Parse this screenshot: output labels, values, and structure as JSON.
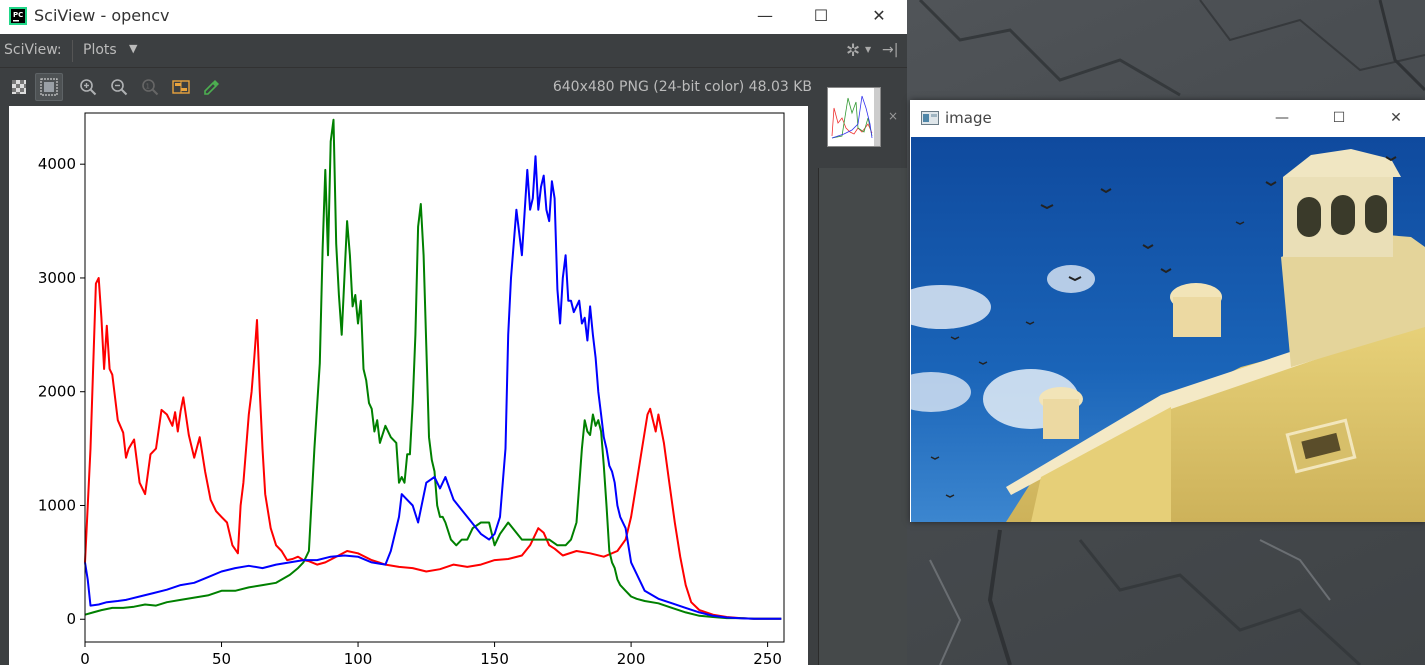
{
  "sciview_window": {
    "title": "SciView - opencv",
    "min_glyph": "—",
    "max_glyph": "☐",
    "close_glyph": "✕"
  },
  "sciview_header": {
    "label": "SciView:",
    "tab": "Plots",
    "tab_caret": "▼",
    "gear_glyph": "✲",
    "gear_caret": "▼",
    "hide_glyph": "→|"
  },
  "toolbar": {
    "image_info": "640x480 PNG (24-bit color) 48.03 KB",
    "icons": [
      "transparency-grid-icon",
      "fit-frame-icon",
      "zoom-in-icon",
      "zoom-out-icon",
      "actual-size-icon",
      "grayscale-icon",
      "color-picker-icon"
    ]
  },
  "thumbnail": {
    "close_glyph": "×"
  },
  "image_window": {
    "title": "image",
    "min_glyph": "—",
    "max_glyph": "☐",
    "close_glyph": "✕"
  },
  "chart_data": {
    "type": "line",
    "title": "",
    "xlabel": "",
    "ylabel": "",
    "xlim": [
      0,
      256
    ],
    "ylim": [
      -200,
      4450
    ],
    "x_ticks": [
      0,
      50,
      100,
      150,
      200,
      250
    ],
    "y_ticks": [
      0,
      1000,
      2000,
      3000,
      4000
    ],
    "grid": false,
    "legend": "none",
    "series": [
      {
        "color": "#ff0000",
        "x": [
          0,
          2,
          4,
          5,
          6,
          7,
          8,
          9,
          10,
          12,
          14,
          15,
          16,
          18,
          20,
          22,
          24,
          26,
          28,
          30,
          32,
          33,
          34,
          35,
          36,
          38,
          40,
          42,
          44,
          46,
          48,
          50,
          52,
          54,
          56,
          57,
          58,
          59,
          60,
          61,
          62,
          63,
          64,
          65,
          66,
          68,
          70,
          72,
          74,
          76,
          78,
          80,
          82,
          85,
          88,
          92,
          96,
          100,
          105,
          110,
          115,
          120,
          125,
          130,
          135,
          140,
          145,
          150,
          155,
          160,
          163,
          166,
          168,
          170,
          172,
          175,
          180,
          185,
          190,
          195,
          198,
          200,
          202,
          204,
          206,
          207,
          208,
          209,
          210,
          212,
          214,
          216,
          218,
          220,
          222,
          225,
          230,
          235,
          240,
          245,
          250,
          255
        ],
        "y": [
          500,
          1500,
          2950,
          3000,
          2650,
          2200,
          2580,
          2200,
          2150,
          1750,
          1640,
          1420,
          1500,
          1580,
          1200,
          1100,
          1450,
          1500,
          1840,
          1800,
          1700,
          1820,
          1650,
          1830,
          1950,
          1620,
          1420,
          1600,
          1300,
          1050,
          950,
          900,
          850,
          650,
          580,
          1000,
          1200,
          1500,
          1800,
          2000,
          2300,
          2630,
          2000,
          1500,
          1100,
          800,
          650,
          600,
          520,
          530,
          550,
          520,
          510,
          480,
          500,
          550,
          600,
          580,
          520,
          480,
          460,
          450,
          420,
          440,
          480,
          460,
          480,
          520,
          530,
          560,
          650,
          800,
          760,
          650,
          620,
          560,
          600,
          580,
          550,
          600,
          700,
          900,
          1200,
          1500,
          1800,
          1850,
          1750,
          1650,
          1800,
          1550,
          1200,
          850,
          550,
          300,
          150,
          80,
          40,
          20,
          10,
          5,
          5,
          5
        ]
      },
      {
        "color": "#008000",
        "x": [
          0,
          3,
          6,
          10,
          14,
          18,
          22,
          26,
          30,
          35,
          40,
          45,
          50,
          55,
          60,
          65,
          70,
          75,
          78,
          80,
          82,
          84,
          86,
          87,
          88,
          89,
          90,
          91,
          92,
          93,
          94,
          95,
          96,
          97,
          98,
          99,
          100,
          101,
          102,
          103,
          104,
          105,
          106,
          107,
          108,
          110,
          112,
          114,
          115,
          116,
          117,
          118,
          119,
          120,
          121,
          122,
          123,
          124,
          125,
          126,
          127,
          128,
          129,
          130,
          131,
          132,
          134,
          136,
          138,
          140,
          142,
          145,
          148,
          150,
          152,
          155,
          160,
          165,
          170,
          173,
          176,
          178,
          180,
          182,
          183,
          184,
          185,
          186,
          187,
          188,
          189,
          190,
          191,
          192,
          193,
          194,
          195,
          196,
          198,
          200,
          202,
          205,
          210,
          215,
          220,
          225,
          230,
          235,
          240,
          245,
          250,
          255
        ],
        "y": [
          40,
          60,
          80,
          100,
          100,
          110,
          130,
          120,
          150,
          170,
          190,
          210,
          250,
          250,
          280,
          300,
          320,
          390,
          450,
          500,
          600,
          1500,
          2250,
          3250,
          3950,
          3200,
          4200,
          4390,
          3300,
          2850,
          2500,
          3000,
          3500,
          3200,
          2750,
          2850,
          2600,
          2800,
          2200,
          2100,
          1900,
          1850,
          1650,
          1750,
          1550,
          1700,
          1600,
          1550,
          1200,
          1250,
          1200,
          1450,
          1450,
          1900,
          2500,
          3450,
          3650,
          3200,
          2400,
          1600,
          1400,
          1300,
          1000,
          900,
          900,
          850,
          700,
          650,
          700,
          700,
          800,
          850,
          850,
          650,
          750,
          850,
          700,
          700,
          700,
          650,
          650,
          700,
          850,
          1500,
          1750,
          1650,
          1620,
          1800,
          1700,
          1750,
          1650,
          1350,
          1000,
          600,
          500,
          450,
          350,
          300,
          250,
          200,
          180,
          160,
          140,
          100,
          60,
          30,
          20,
          10,
          10,
          5,
          5,
          5
        ]
      },
      {
        "color": "#0000ff",
        "x": [
          0,
          1,
          2,
          5,
          8,
          12,
          15,
          20,
          25,
          30,
          35,
          40,
          45,
          50,
          55,
          60,
          65,
          70,
          75,
          80,
          85,
          90,
          95,
          100,
          105,
          110,
          112,
          115,
          116,
          118,
          120,
          122,
          125,
          128,
          130,
          132,
          135,
          140,
          145,
          148,
          150,
          152,
          154,
          155,
          156,
          158,
          160,
          162,
          163,
          164,
          165,
          166,
          167,
          168,
          169,
          170,
          171,
          172,
          173,
          174,
          175,
          176,
          177,
          178,
          179,
          180,
          181,
          182,
          183,
          184,
          185,
          186,
          187,
          188,
          189,
          190,
          191,
          192,
          193,
          194,
          195,
          196,
          198,
          200,
          205,
          210,
          215,
          220,
          225,
          230,
          235,
          240,
          245,
          250,
          255
        ],
        "y": [
          500,
          350,
          120,
          130,
          150,
          160,
          170,
          200,
          230,
          260,
          300,
          320,
          370,
          420,
          450,
          470,
          450,
          480,
          500,
          520,
          520,
          550,
          560,
          550,
          500,
          480,
          600,
          900,
          1100,
          1050,
          1000,
          850,
          1200,
          1250,
          1150,
          1250,
          1050,
          900,
          750,
          700,
          750,
          900,
          1500,
          2500,
          3000,
          3600,
          3200,
          3950,
          3600,
          3700,
          4070,
          3600,
          3800,
          3900,
          3600,
          3500,
          3850,
          3700,
          2900,
          2600,
          3000,
          3200,
          2800,
          2800,
          2700,
          2750,
          2800,
          2600,
          2650,
          2450,
          2750,
          2500,
          2300,
          2000,
          1800,
          1600,
          1500,
          1350,
          1300,
          1200,
          1000,
          900,
          800,
          500,
          250,
          180,
          140,
          100,
          60,
          30,
          15,
          8,
          5,
          5,
          5
        ]
      }
    ]
  }
}
